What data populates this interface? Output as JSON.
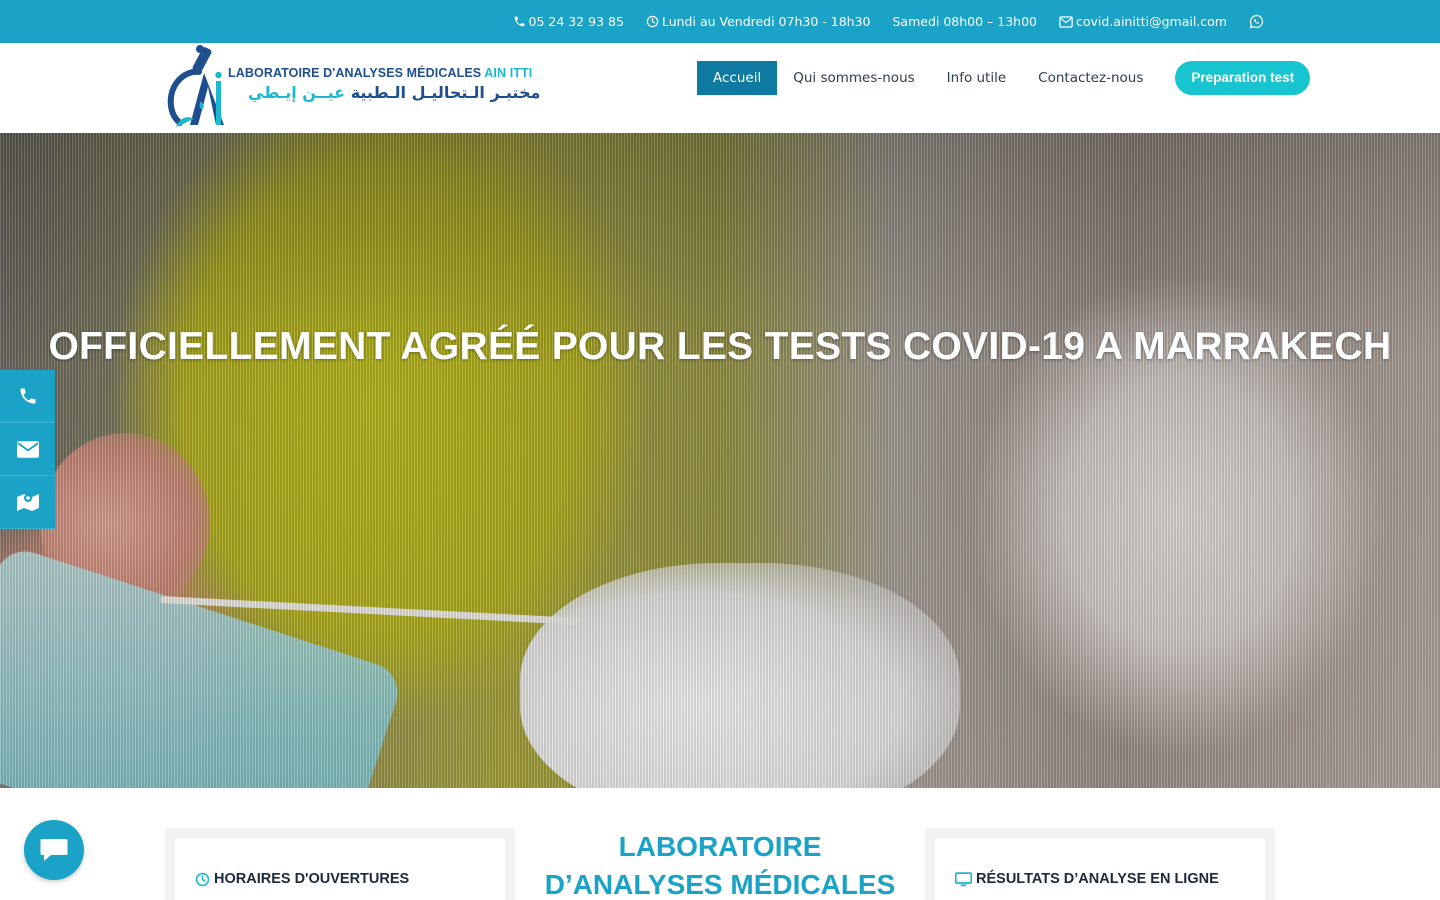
{
  "topbar": {
    "phone": "05 24 32 93 85",
    "weekday_hours": "Lundi au Vendredi 07h30 - 18h30",
    "saturday_hours": "Samedi 08h00 – 13h00",
    "email": "covid.ainitti@gmail.com",
    "icons": [
      "phone-icon",
      "clock-icon",
      "envelope-icon",
      "whatsapp-icon"
    ]
  },
  "logo": {
    "name_fr": "LABORATOIRE D'ANALYSES MÉDICALES",
    "name_fr_highlight": "AIN ITTI",
    "name_ar": "مختبـر الـتحاليـل الـطبية",
    "name_ar_highlight": "عيــن إيـطي"
  },
  "nav": {
    "items": [
      {
        "label": "Accueil",
        "active": true
      },
      {
        "label": "Qui sommes-nous",
        "active": false
      },
      {
        "label": "Info utile",
        "active": false
      },
      {
        "label": "Contactez-nous",
        "active": false
      }
    ],
    "cta": "Preparation test"
  },
  "hero": {
    "title": "OFFICIELLEMENT AGRÉÉ POUR LES TESTS COVID-19 A MARRAKECH"
  },
  "side_buttons": [
    "phone-icon",
    "envelope-icon",
    "map-icon"
  ],
  "cards": {
    "left_title": "HORAIRES D'OUVERTURES",
    "right_title": "RÉSULTATS D’ANALYSE EN LIGNE"
  },
  "center": {
    "line1": "LABORATOIRE",
    "line2": "D’ANALYSES MÉDICALES"
  },
  "colors": {
    "primary": "#1aa3c7",
    "nav_active": "#0f7aa1",
    "cta": "#18c4cf",
    "logo_blue": "#1f4f8e",
    "logo_teal": "#1cb8cf"
  }
}
